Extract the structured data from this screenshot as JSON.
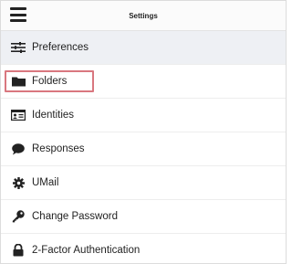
{
  "header": {
    "title": "Settings",
    "menu_icon": "hamburger-menu-icon"
  },
  "menu": {
    "items": [
      {
        "id": "preferences",
        "label": "Preferences",
        "icon": "sliders-icon",
        "active": true
      },
      {
        "id": "folders",
        "label": "Folders",
        "icon": "folder-icon",
        "highlighted": true
      },
      {
        "id": "identities",
        "label": "Identities",
        "icon": "id-card-icon"
      },
      {
        "id": "responses",
        "label": "Responses",
        "icon": "speech-bubble-icon"
      },
      {
        "id": "umail",
        "label": "UMail",
        "icon": "gear-icon"
      },
      {
        "id": "change-password",
        "label": "Change Password",
        "icon": "key-icon"
      },
      {
        "id": "two-factor",
        "label": "2-Factor Authentication",
        "icon": "lock-icon"
      }
    ]
  },
  "colors": {
    "active_row_bg": "#eef0f4",
    "highlight_border": "#d9777f",
    "text": "#222222"
  }
}
